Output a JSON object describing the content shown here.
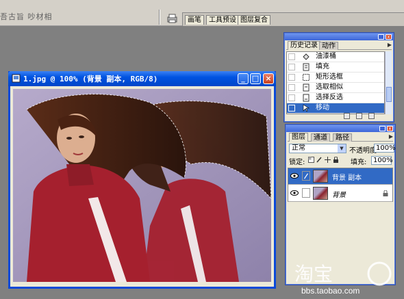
{
  "options_bar": {
    "align_icons": "吾古旨  吵材相",
    "palette_well_tabs": [
      "画笔",
      "工具预设",
      "图层复合"
    ]
  },
  "document": {
    "title": "1.jpg @ 100% (背景 副本, RGB/8)",
    "min_label": "_",
    "max_label": "□",
    "close_label": "×"
  },
  "history": {
    "tabs": [
      "历史记录",
      "动作"
    ],
    "items": [
      {
        "label": "油漆桶",
        "icon": "paint-bucket-icon"
      },
      {
        "label": "填充",
        "icon": "fill-icon"
      },
      {
        "label": "矩形选框",
        "icon": "rect-marquee-icon"
      },
      {
        "label": "选取相似",
        "icon": "select-similar-icon"
      },
      {
        "label": "选择反选",
        "icon": "select-inverse-icon"
      },
      {
        "label": "移动",
        "icon": "move-icon",
        "selected": true
      }
    ]
  },
  "layers": {
    "tabs": [
      "图层",
      "通道",
      "路径"
    ],
    "blend_mode": "正常",
    "opacity_label": "不透明度:",
    "opacity": "100%",
    "lock_label": "锁定:",
    "fill_label": "填充:",
    "fill": "100%",
    "items": [
      {
        "name": "背景 副本",
        "selected": true
      },
      {
        "name": "背景",
        "locked": true
      }
    ]
  },
  "watermark": {
    "logo": "淘宝",
    "url": "bbs.taobao.com"
  },
  "colors": {
    "xp_blue": "#0053e1",
    "selection": "#316ac5",
    "workspace": "#808080",
    "dress_red": "#a5202e"
  }
}
